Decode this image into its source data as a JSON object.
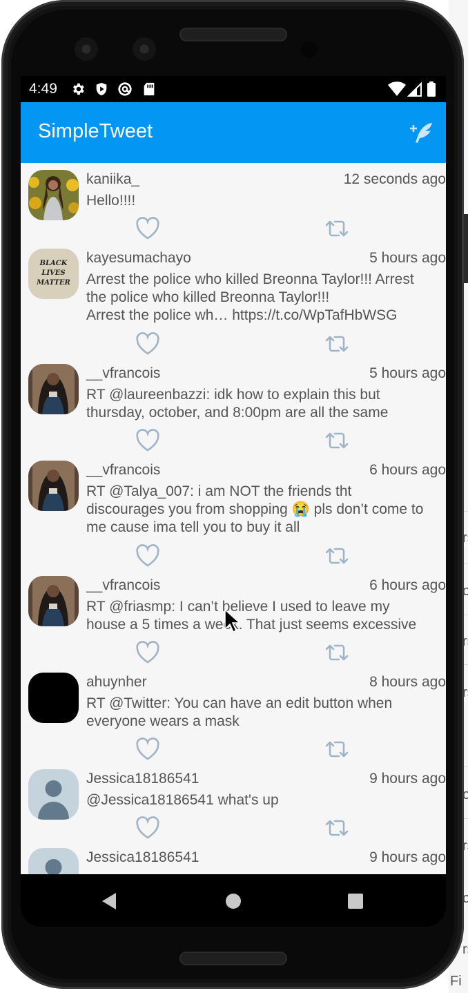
{
  "status_bar": {
    "time": "4:49",
    "left_icons": [
      "settings-icon",
      "shield-play-icon",
      "at-sign-icon",
      "sd-card-icon"
    ],
    "right_icons": [
      "wifi-icon",
      "cell-signal-icon",
      "battery-icon"
    ]
  },
  "app_bar": {
    "title": "SimpleTweet",
    "compose_icon": "compose-tweet-icon",
    "color": "#0396f2"
  },
  "tweets": [
    {
      "username": "kaniika_",
      "time": "12 seconds ago",
      "body": "Hello!!!!",
      "avatar": "photo-person-sunflowers"
    },
    {
      "username": "kayesumachayo",
      "time": "5 hours ago",
      "body": "Arrest the police who killed Breonna Taylor!!! Arrest\nthe police who killed Breonna Taylor!!!\nArrest the police wh… https://t.co/WpTafHbWSG",
      "avatar": "black-lives-matter-sign",
      "avatar_text": "BLACK LIVES MATTER"
    },
    {
      "username": "__vfrancois",
      "time": "5 hours ago",
      "body": "RT @laureenbazzi: idk how to explain this but\nthursday, october, and 8:00pm are all the same",
      "avatar": "photo-person-mirror"
    },
    {
      "username": "__vfrancois",
      "time": "6 hours ago",
      "body": "RT @Talya_007: i am NOT the friends tht\ndiscourages you from shopping 😭 pls don’t come to\nme cause ima tell you to buy it all",
      "avatar": "photo-person-mirror"
    },
    {
      "username": "__vfrancois",
      "time": "6 hours ago",
      "body": "RT @friasmp: I can’t believe I used to leave my\nhouse a 5 times a week. That just seems excessive",
      "avatar": "photo-person-mirror"
    },
    {
      "username": "ahuynher",
      "time": "8 hours ago",
      "body": "RT @Twitter: You can have an edit button when\neveryone wears a mask",
      "avatar": "black-square"
    },
    {
      "username": "Jessica18186541",
      "time": "9 hours ago",
      "body": "@Jessica18186541 what's up",
      "avatar": "default-person-silhouette"
    },
    {
      "username": "Jessica18186541",
      "time": "9 hours ago",
      "body": "",
      "avatar": "default-person-silhouette"
    }
  ],
  "actions": {
    "like_icon": "heart-outline-icon",
    "retweet_icon": "retweet-icon",
    "icon_color": "#9fb4c4"
  },
  "nav_bar": {
    "back_icon": "back-triangle-icon",
    "home_icon": "home-circle-icon",
    "recents_icon": "recents-square-icon"
  },
  "background_glyphs": [
    "rs",
    "o",
    "rs",
    "rs",
    "o",
    "rs",
    "o",
    "rs",
    "Fi"
  ]
}
